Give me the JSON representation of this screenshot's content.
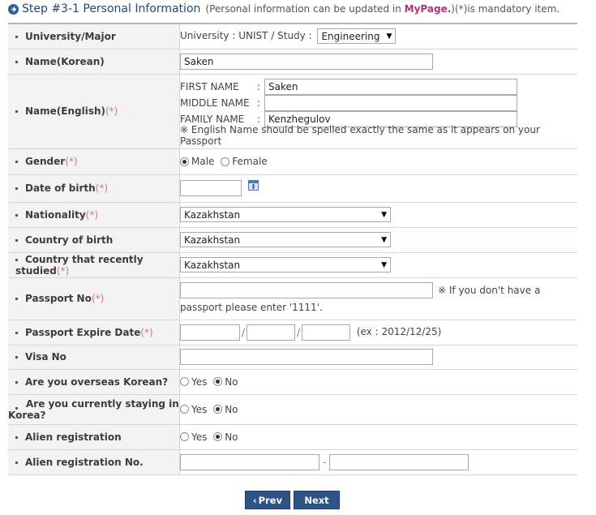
{
  "header": {
    "title": "Step #3-1 Personal Information",
    "note_prefix": "(Personal information can be updated in",
    "note_link": "MyPage.",
    "note_suffix": ")(*)is mandatory item."
  },
  "required_mark": "(*)",
  "fields": {
    "university": {
      "label": "University/Major",
      "text": "University : UNIST / Study :",
      "study_value": "Engineering"
    },
    "name_korean": {
      "label": "Name(Korean)",
      "value": "Saken"
    },
    "name_english": {
      "label": "Name(English)",
      "first_label": "FIRST NAME",
      "first_value": "Saken",
      "middle_label": "MIDDLE NAME",
      "middle_value": "",
      "family_label": "FAMILY NAME",
      "family_value": "Kenzhegulov",
      "colon": ":",
      "note": "※ English Name should be spelled exactly the same as it appears on your Passport"
    },
    "gender": {
      "label": "Gender",
      "male": "Male",
      "female": "Female",
      "selected": "Male"
    },
    "dob": {
      "label": "Date of birth",
      "value": ""
    },
    "nationality": {
      "label": "Nationality",
      "value": "Kazakhstan"
    },
    "country_birth": {
      "label": "Country of birth",
      "value": "Kazakhstan"
    },
    "country_studied": {
      "label": "Country that recently studied",
      "value": "Kazakhstan"
    },
    "passport_no": {
      "label": "Passport No",
      "value": "",
      "note1": "※ If you don't have a",
      "note2": "passport please enter '1111'."
    },
    "passport_expire": {
      "label": "Passport Expire Date",
      "sep": "/",
      "example": "(ex : 2012/12/25)"
    },
    "visa_no": {
      "label": "Visa No",
      "value": ""
    },
    "overseas_korean": {
      "label": "Are you overseas Korean?",
      "yes": "Yes",
      "no": "No",
      "selected": "No"
    },
    "staying_korea": {
      "label_line1": "Are you currently staying in",
      "label_line2": "Korea?",
      "yes": "Yes",
      "no": "No",
      "selected": "No"
    },
    "alien_registration": {
      "label": "Alien registration",
      "yes": "Yes",
      "no": "No",
      "selected": "No"
    },
    "alien_registration_no": {
      "label": "Alien registration No.",
      "sep": "-"
    }
  },
  "buttons": {
    "prev": "Prev",
    "next": "Next"
  },
  "colors": {
    "accent": "#2e5389",
    "link": "#b0337a",
    "required": "#e0727a"
  }
}
